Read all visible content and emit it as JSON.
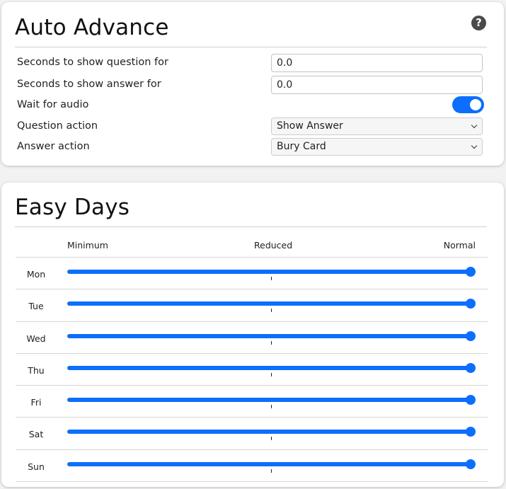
{
  "auto_advance": {
    "title": "Auto Advance",
    "help_icon": "help-circle-icon",
    "seconds_question": {
      "label": "Seconds to show question for",
      "value": "0.0"
    },
    "seconds_answer": {
      "label": "Seconds to show answer for",
      "value": "0.0"
    },
    "wait_audio": {
      "label": "Wait for audio",
      "enabled": true
    },
    "question_action": {
      "label": "Question action",
      "selected": "Show Answer"
    },
    "answer_action": {
      "label": "Answer action",
      "selected": "Bury Card"
    }
  },
  "easy_days": {
    "title": "Easy Days",
    "scale": {
      "min": "Minimum",
      "mid": "Reduced",
      "max": "Normal"
    },
    "days": [
      {
        "label": "Mon",
        "level": 1.0
      },
      {
        "label": "Tue",
        "level": 1.0
      },
      {
        "label": "Wed",
        "level": 1.0
      },
      {
        "label": "Thu",
        "level": 1.0
      },
      {
        "label": "Fri",
        "level": 1.0
      },
      {
        "label": "Sat",
        "level": 1.0
      },
      {
        "label": "Sun",
        "level": 1.0
      }
    ]
  },
  "colors": {
    "accent": "#0d6efd",
    "background": "#f2f2f2",
    "card": "#ffffff"
  }
}
